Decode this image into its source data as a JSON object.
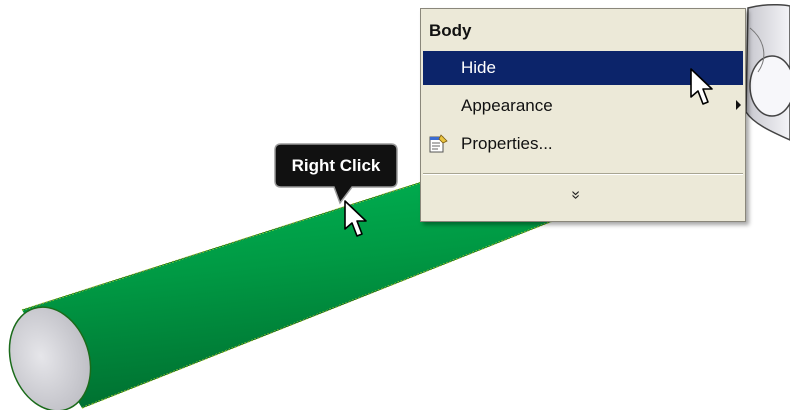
{
  "tooltip": {
    "label": "Right Click"
  },
  "context_menu": {
    "header": "Body",
    "items": [
      {
        "label": "Hide",
        "selected": true,
        "icon": "none"
      },
      {
        "label": "Appearance",
        "selected": false,
        "icon": "submenu-arrow"
      },
      {
        "label": "Properties...",
        "selected": false,
        "icon": "properties-icon"
      }
    ],
    "expand_glyph": "»"
  },
  "colors": {
    "cylinder_body": "#009a44",
    "cylinder_end_cap": "#d3d3d8",
    "menu_background": "#ece9d8",
    "menu_selected": "#0c246a",
    "tooltip_background": "#111111"
  }
}
